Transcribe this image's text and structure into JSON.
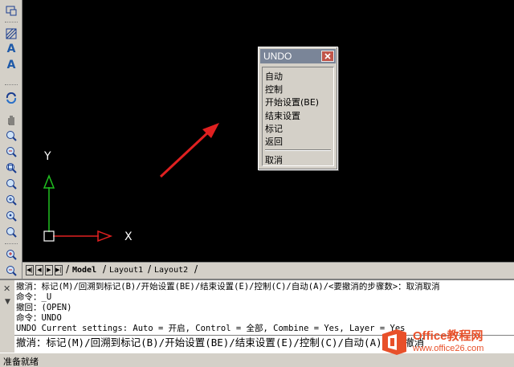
{
  "toolbar": {
    "icons": [
      "viewport-icon",
      "hatch-icon",
      "text-icon",
      "text-style-icon",
      "regen-icon",
      "pan-icon",
      "zoom-realtime-icon",
      "zoom-previous-icon",
      "zoom-window-icon",
      "zoom-dynamic-icon",
      "zoom-scale-icon",
      "zoom-center-icon",
      "zoom-object-icon",
      "zoom-in-icon",
      "zoom-out-icon"
    ],
    "text_letter": "A"
  },
  "canvas": {
    "background": "#000000",
    "ucs": {
      "x_label": "X",
      "y_label": "Y",
      "x_color": "#e02020",
      "y_color": "#20c020"
    },
    "arrow_color": "#e02020"
  },
  "undo_menu": {
    "title": "UNDO",
    "close_label": "x",
    "items": [
      "自动",
      "控制",
      "开始设置(BE)",
      "结束设置",
      "标记",
      "返回"
    ],
    "cancel_label": "取消"
  },
  "tabs": {
    "nav": [
      "◀|",
      "◀",
      "▶",
      "▶|"
    ],
    "items": [
      {
        "label": "Model",
        "active": true
      },
      {
        "label": "Layout1",
        "active": false
      },
      {
        "label": "Layout2",
        "active": false
      }
    ]
  },
  "command": {
    "close_label": "✕",
    "history": [
      "撤消：标记(M)/回溯到标记(B)/开始设置(BE)/结束设置(E)/控制(C)/自动(A)/<要撤消的步骤数>：取消取消",
      "命令：_U",
      "撤回：(OPEN)",
      "命令：UNDO",
      "UNDO Current settings: Auto = 开启, Control = 全部, Combine = Yes, Layer = Yes"
    ],
    "prompt": "撤消：标记(M)/回溯到标记(B)/开始设置(BE)/结束设置(E)/控制(C)/自动(A)/<要撤消"
  },
  "status": {
    "text": "准备就绪"
  },
  "watermark": {
    "title": "Office教程网",
    "subtitle": "www.office26.com",
    "color": "#e8502a"
  }
}
